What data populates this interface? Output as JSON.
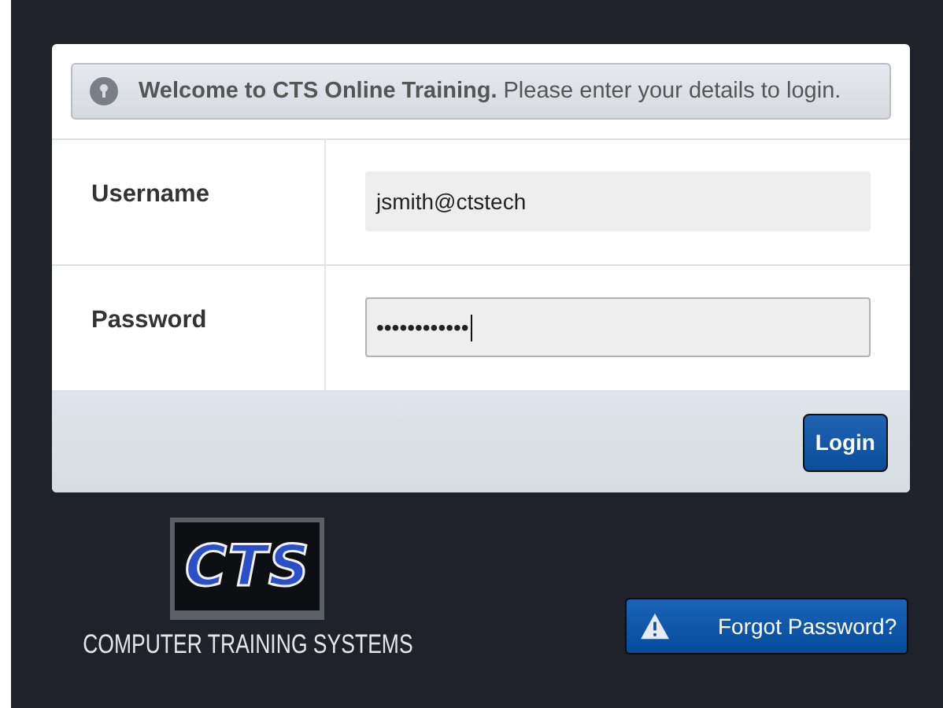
{
  "banner": {
    "text": "**Welcome to CTS Online Training.** Please enter your details to login."
  },
  "fields": [
    {
      "label": "Username",
      "value": "jsmith@ctstech",
      "focused": false
    },
    {
      "label": "Password",
      "value": "••••••••••••",
      "focused": true
    }
  ],
  "login_button": "Login",
  "logo": {
    "mark": "CTS",
    "caption": "COMPUTER TRAINING SYSTEMS"
  },
  "forgot_button": "Forgot Password?"
}
